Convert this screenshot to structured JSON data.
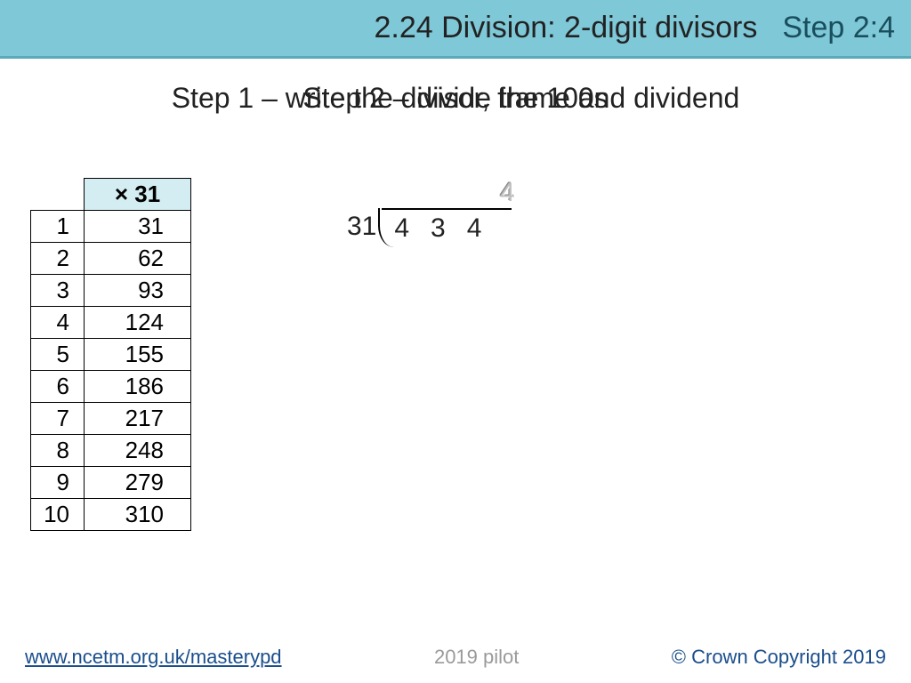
{
  "header": {
    "title": "2.24 Division: 2-digit divisors",
    "step": "Step 2:4"
  },
  "subtitle_back": "Step 1 – write the divisor, frame and dividend",
  "subtitle_front": "Step 2 – divide the 100s",
  "table": {
    "header": "× 31",
    "rows": [
      {
        "n": "1",
        "v": "31"
      },
      {
        "n": "2",
        "v": "62"
      },
      {
        "n": "3",
        "v": "93"
      },
      {
        "n": "4",
        "v": "124"
      },
      {
        "n": "5",
        "v": "155"
      },
      {
        "n": "6",
        "v": "186"
      },
      {
        "n": "7",
        "v": "217"
      },
      {
        "n": "8",
        "v": "248"
      },
      {
        "n": "9",
        "v": "279"
      },
      {
        "n": "10",
        "v": "310"
      }
    ]
  },
  "division": {
    "quotient_partial": "4",
    "divisor": "31",
    "dividend": "434"
  },
  "footer": {
    "url": "www.ncetm.org.uk/masterypd",
    "pilot": "2019 pilot",
    "copyright": "© Crown Copyright 2019"
  }
}
